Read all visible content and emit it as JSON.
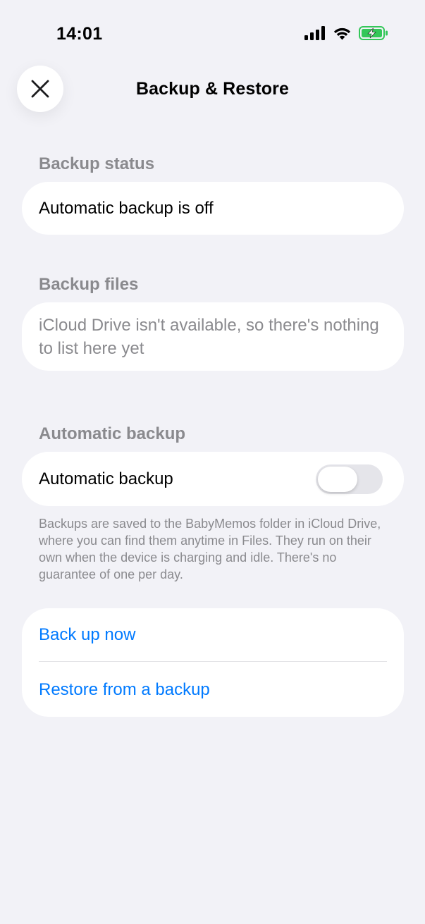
{
  "status_bar": {
    "time": "14:01",
    "icons": [
      "signal-icon",
      "wifi-icon",
      "battery-charging-icon"
    ]
  },
  "header": {
    "title": "Backup & Restore",
    "close_icon": "close-icon"
  },
  "sections": {
    "backup_status": {
      "header": "Backup status",
      "value": "Automatic backup is off"
    },
    "backup_files": {
      "header": "Backup files",
      "empty_message": "iCloud Drive isn't available, so there's nothing to list here yet"
    },
    "automatic_backup": {
      "header": "Automatic backup",
      "toggle_label": "Automatic backup",
      "toggle_on": false,
      "footer": "Backups are saved to the BabyMemos folder in iCloud Drive, where you can find them anytime in Files. They run on their own when the device is charging and idle. There's no guarantee of one per day."
    },
    "actions": {
      "back_up_now": "Back up now",
      "restore": "Restore from a backup"
    }
  },
  "colors": {
    "background": "#F2F2F7",
    "card": "#FFFFFF",
    "accent": "#007AFF",
    "secondary_text": "#8A8A8E",
    "battery_charging": "#34C759"
  }
}
